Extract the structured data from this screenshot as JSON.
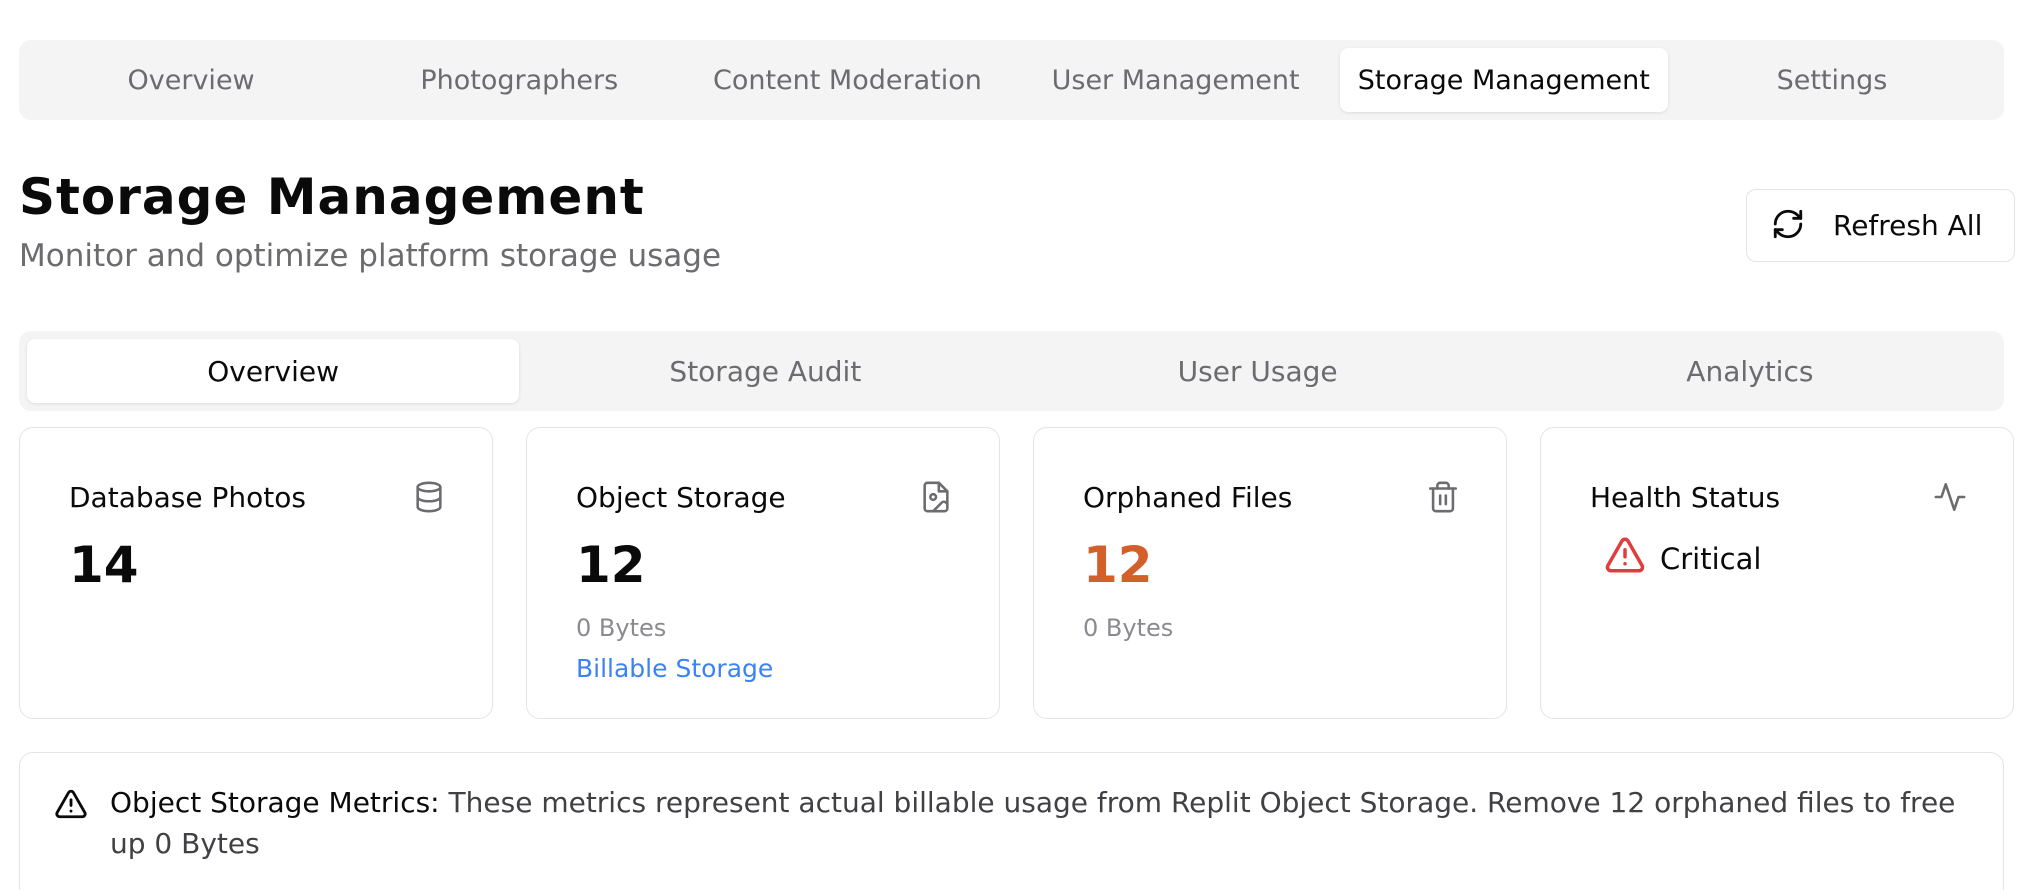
{
  "top_nav": {
    "tabs": [
      {
        "label": "Overview"
      },
      {
        "label": "Photographers"
      },
      {
        "label": "Content Moderation"
      },
      {
        "label": "User Management"
      },
      {
        "label": "Storage Management"
      },
      {
        "label": "Settings"
      }
    ],
    "active": "Storage Management"
  },
  "header": {
    "title": "Storage Management",
    "subtitle": "Monitor and optimize platform storage usage",
    "refresh_label": "Refresh All",
    "refresh_icon": "refresh-icon"
  },
  "sub_tabs": {
    "tabs": [
      {
        "label": "Overview"
      },
      {
        "label": "Storage Audit"
      },
      {
        "label": "User Usage"
      },
      {
        "label": "Analytics"
      }
    ],
    "active": "Overview"
  },
  "cards": {
    "database_photos": {
      "title": "Database Photos",
      "value": "14",
      "icon": "database-icon"
    },
    "object_storage": {
      "title": "Object Storage",
      "value": "12",
      "size": "0 Bytes",
      "link": "Billable Storage",
      "icon": "file-image-icon"
    },
    "orphaned_files": {
      "title": "Orphaned Files",
      "value": "12",
      "size": "0 Bytes",
      "icon": "trash-icon",
      "value_color": "#d35f2a"
    },
    "health_status": {
      "title": "Health Status",
      "status": "Critical",
      "icon": "activity-icon",
      "status_icon": "warning-triangle-icon",
      "status_color": "#e03e3e"
    }
  },
  "alert": {
    "heading": "Object Storage Metrics:",
    "message": " These metrics represent actual billable usage from Replit Object Storage. Remove 12 orphaned files to free up 0 Bytes",
    "icon": "warning-triangle-icon"
  },
  "colors": {
    "link": "#3b82f6",
    "warning_orange": "#d35f2a",
    "critical_red": "#e03e3e",
    "muted_text": "#6b6b70",
    "tab_bg": "#f4f4f5"
  }
}
